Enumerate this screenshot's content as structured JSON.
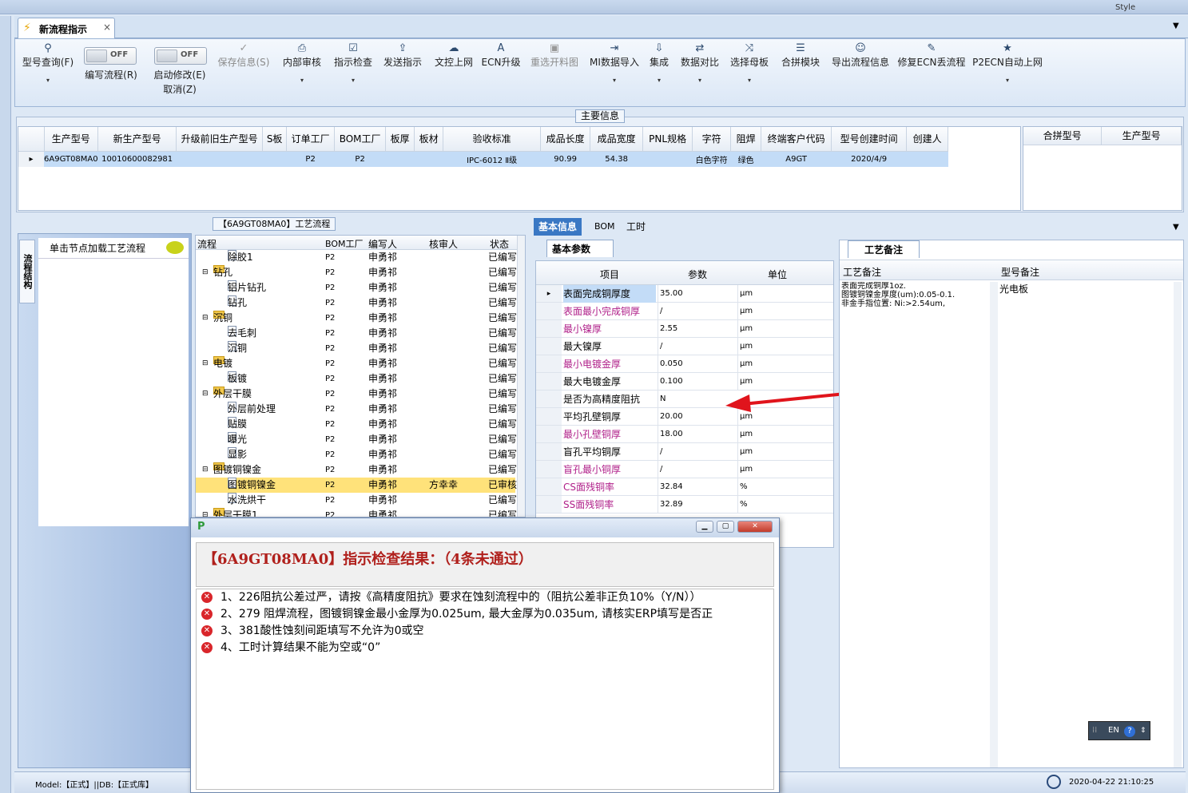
{
  "window": {
    "top_right_label": "Style"
  },
  "tab": {
    "title": "新流程指示",
    "close": "×"
  },
  "ribbon": {
    "buttons": [
      {
        "label": "型号查询(F)",
        "icon": "search-icon",
        "glyph": "⚲"
      },
      {
        "label": "编写流程(R)",
        "toggle": "OFF"
      },
      {
        "label": "启动修改(E)",
        "sub": "取消(Z)",
        "toggle": "OFF"
      },
      {
        "label": "保存信息(S)",
        "icon": "check-icon",
        "glyph": "✓"
      },
      {
        "label": "内部审核",
        "icon": "printer-icon",
        "glyph": "⎙"
      },
      {
        "label": "指示检查",
        "icon": "clipboard-icon",
        "glyph": "☑"
      },
      {
        "label": "发送指示",
        "icon": "upload-icon",
        "glyph": "⇪"
      },
      {
        "label": "文控上网",
        "icon": "cloud-upload-icon",
        "glyph": "☁"
      },
      {
        "label": "ECN升级",
        "icon": "ecn-icon",
        "glyph": "A"
      },
      {
        "label": "重选开料图",
        "icon": "image-icon",
        "glyph": "▣"
      },
      {
        "label": "MI数据导入",
        "icon": "import-icon",
        "glyph": "⇥"
      },
      {
        "label": "集成",
        "icon": "download-icon",
        "glyph": "⇩"
      },
      {
        "label": "数据对比",
        "icon": "compare-icon",
        "glyph": "⇄"
      },
      {
        "label": "选择母板",
        "icon": "shuffle-icon",
        "glyph": "⤨"
      },
      {
        "label": "合拼模块",
        "icon": "list-icon",
        "glyph": "☰"
      },
      {
        "label": "导出流程信息",
        "icon": "smile-icon",
        "glyph": "☺"
      },
      {
        "label": "修复ECN丢流程",
        "icon": "wrench-icon",
        "glyph": "✎"
      },
      {
        "label": "P2ECN自动上网",
        "icon": "star-icon",
        "glyph": "★"
      }
    ]
  },
  "main_info": {
    "title": "主要信息",
    "columns": [
      "生产型号",
      "新生产型号",
      "升级前旧生产型号",
      "S板",
      "订单工厂",
      "BOM工厂",
      "板厚",
      "板材",
      "验收标准",
      "成品长度",
      "成品宽度",
      "PNL规格",
      "字符",
      "阻焊",
      "终端客户代码",
      "型号创建时间",
      "创建人"
    ],
    "row": [
      "6A9GT08MA0",
      "10010600082981",
      "",
      "",
      "P2",
      "P2",
      "",
      "",
      "IPC-6012 Ⅱ级",
      "90.99",
      "54.38",
      "",
      "白色字符",
      "绿色",
      "A9GT",
      "2020/4/9",
      ""
    ],
    "side_columns": [
      "合拼型号",
      "生产型号"
    ]
  },
  "left_nav": {
    "vertical_label": "流程结构",
    "header": "单击节点加载工艺流程"
  },
  "tree": {
    "title": "【6A9GT08MA0】工艺流程",
    "columns": [
      "流程",
      "BOM工厂",
      "编写人",
      "核审人",
      "状态"
    ],
    "rows": [
      {
        "name": "除胶1",
        "level": 2,
        "bom": "P2",
        "writer": "申勇祁",
        "reviewer": "",
        "status": "已编写"
      },
      {
        "name": "钻孔",
        "level": 1,
        "bom": "P2",
        "writer": "申勇祁",
        "reviewer": "",
        "status": "已编写"
      },
      {
        "name": "铝片钻孔",
        "level": 2,
        "bom": "P2",
        "writer": "申勇祁",
        "reviewer": "",
        "status": "已编写"
      },
      {
        "name": "钻孔",
        "level": 2,
        "bom": "P2",
        "writer": "申勇祁",
        "reviewer": "",
        "status": "已编写"
      },
      {
        "name": "沉铜",
        "level": 1,
        "bom": "P2",
        "writer": "申勇祁",
        "reviewer": "",
        "status": "已编写"
      },
      {
        "name": "去毛刺",
        "level": 2,
        "bom": "P2",
        "writer": "申勇祁",
        "reviewer": "",
        "status": "已编写"
      },
      {
        "name": "沉铜",
        "level": 2,
        "bom": "P2",
        "writer": "申勇祁",
        "reviewer": "",
        "status": "已编写"
      },
      {
        "name": "电镀",
        "level": 1,
        "bom": "P2",
        "writer": "申勇祁",
        "reviewer": "",
        "status": "已编写"
      },
      {
        "name": "板镀",
        "level": 2,
        "bom": "P2",
        "writer": "申勇祁",
        "reviewer": "",
        "status": "已编写"
      },
      {
        "name": "外层干膜",
        "level": 1,
        "bom": "P2",
        "writer": "申勇祁",
        "reviewer": "",
        "status": "已编写"
      },
      {
        "name": "外层前处理",
        "level": 2,
        "bom": "P2",
        "writer": "申勇祁",
        "reviewer": "",
        "status": "已编写"
      },
      {
        "name": "贴膜",
        "level": 2,
        "bom": "P2",
        "writer": "申勇祁",
        "reviewer": "",
        "status": "已编写"
      },
      {
        "name": "曝光",
        "level": 2,
        "bom": "P2",
        "writer": "申勇祁",
        "reviewer": "",
        "status": "已编写"
      },
      {
        "name": "显影",
        "level": 2,
        "bom": "P2",
        "writer": "申勇祁",
        "reviewer": "",
        "status": "已编写"
      },
      {
        "name": "图镀铜镍金",
        "level": 1,
        "bom": "P2",
        "writer": "申勇祁",
        "reviewer": "",
        "status": "已编写"
      },
      {
        "name": "图镀铜镍金",
        "level": 2,
        "bom": "P2",
        "writer": "申勇祁",
        "reviewer": "方幸幸",
        "status": "已审核",
        "selected": true
      },
      {
        "name": "水洗烘干",
        "level": 2,
        "bom": "P2",
        "writer": "申勇祁",
        "reviewer": "",
        "status": "已编写"
      },
      {
        "name": "外层干膜1",
        "level": 1,
        "bom": "P2",
        "writer": "申勇祁",
        "reviewer": "",
        "status": "已编写"
      }
    ]
  },
  "right_tabs": [
    "基本信息",
    "BOM",
    "工时"
  ],
  "params": {
    "subtab": "基本参数",
    "columns": [
      "项目",
      "参数",
      "单位"
    ],
    "rows": [
      {
        "item": "表面完成铜厚度",
        "value": "35.00",
        "unit": "μm",
        "hl": false
      },
      {
        "item": "表面最小完成铜厚",
        "value": "/",
        "unit": "μm",
        "hl": true
      },
      {
        "item": "最小镍厚",
        "value": "2.55",
        "unit": "μm",
        "hl": true
      },
      {
        "item": "最大镍厚",
        "value": "/",
        "unit": "μm",
        "hl": false
      },
      {
        "item": "最小电镀金厚",
        "value": "0.050",
        "unit": "μm",
        "hl": true
      },
      {
        "item": "最大电镀金厚",
        "value": "0.100",
        "unit": "μm",
        "hl": false
      },
      {
        "item": "是否为高精度阻抗",
        "value": "N",
        "unit": "",
        "hl": false
      },
      {
        "item": "平均孔壁铜厚",
        "value": "20.00",
        "unit": "μm",
        "hl": false
      },
      {
        "item": "最小孔壁铜厚",
        "value": "18.00",
        "unit": "μm",
        "hl": true
      },
      {
        "item": "盲孔平均铜厚",
        "value": "/",
        "unit": "μm",
        "hl": false
      },
      {
        "item": "盲孔最小铜厚",
        "value": "/",
        "unit": "μm",
        "hl": true
      },
      {
        "item": "CS面残铜率",
        "value": "32.84",
        "unit": "%",
        "hl": true
      },
      {
        "item": "SS面残铜率",
        "value": "32.89",
        "unit": "%",
        "hl": true
      }
    ]
  },
  "notes": {
    "tab": "工艺备注",
    "col1": "工艺备注",
    "col2": "型号备注",
    "text1": "表面完成铜厚1oz.\n图镀铜镍金厚度(um):0.05-0.1.\n非金手指位置: Ni:>2.54um,",
    "text2": "光电板"
  },
  "dialog": {
    "title": "【6A9GT08MA0】指示检查结果：（4条未通过）",
    "items": [
      "1、226阻抗公差过严，请按《高精度阻抗》要求在蚀刻流程中的（阻抗公差非正负10%（Y/N））",
      "2、279 阻焊流程，图镀铜镍金最小金厚为0.025um, 最大金厚为0.035um, 请核实ERP填写是否正",
      "3、381酸性蚀刻间距填写不允许为0或空",
      "4、工时计算结果不能为空或“0”"
    ]
  },
  "status": {
    "left": "Model:【正式】||DB:【正式库】",
    "datetime": "2020-04-22 21:10:25"
  },
  "ime": {
    "label": "EN"
  },
  "colors": {
    "accent": "#c3dcf7",
    "error": "#d9262b",
    "arrow": "#e0141c",
    "highlight": "#ffe27a",
    "title_red": "#b0201c"
  }
}
